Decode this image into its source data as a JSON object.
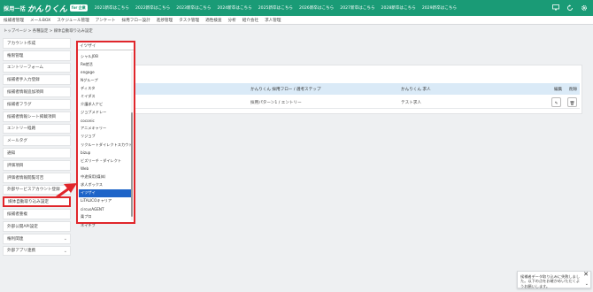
{
  "header": {
    "logo_prefix": "採用一括",
    "logo_name": "かんりくん",
    "logo_badge": "for 企業",
    "year_links": [
      "2021新卒はこちら",
      "2022新卒はこちら",
      "2023新卒はこちら",
      "2024新卒はこちら",
      "2025新卒はこちら",
      "2026新卒はこちら",
      "2027新卒はこちら",
      "2028新卒はこちら",
      "2029新卒はこちら"
    ],
    "icons": [
      "monitor-icon",
      "refresh-icon",
      "gear-icon"
    ]
  },
  "menu": [
    "候補者管理",
    "メールBOX",
    "スケジュール管理",
    "アンケート",
    "採用フロー設計",
    "進捗管理",
    "タスク管理",
    "適性検査",
    "分析",
    "紹介会社",
    "求人管理"
  ],
  "breadcrumb": "トップページ > 各種設定 > 媒体自動取り込み設定",
  "sidebar": [
    {
      "label": "アカウント作成"
    },
    {
      "label": "権限管理"
    },
    {
      "label": "エントリーフォーム"
    },
    {
      "label": "候補者手入力登録"
    },
    {
      "label": "候補者情報追加項目"
    },
    {
      "label": "候補者フラグ"
    },
    {
      "label": "候補者情報シート掲載項目"
    },
    {
      "label": "エントリー経路"
    },
    {
      "label": "メールタグ"
    },
    {
      "label": "通知"
    },
    {
      "label": "評価項目"
    },
    {
      "label": "評価者情報閲覧可否"
    },
    {
      "label": "外部サービスアカウント登録"
    },
    {
      "label": "媒体自動取り込み設定",
      "active": true
    },
    {
      "label": "候補者重複"
    },
    {
      "label": "外部公開API設定"
    },
    {
      "label": "権利関連",
      "chevron": true
    },
    {
      "label": "外部アプリ連携",
      "chevron": true
    }
  ],
  "table": {
    "headers": [
      "かんりくん 採用フロー / 選考ステップ",
      "かんりくん 求人",
      "編集",
      "削除"
    ],
    "row": {
      "flow": "採用パターン1 / エントリー",
      "job": "テスト求人"
    }
  },
  "dropdown": {
    "selected_value": "イツザイ",
    "options": [
      "シャルJOB",
      "Re就活",
      "engage",
      "Nグループ",
      "ディスタ",
      "ミイダス",
      "介護求人ナビ",
      "ジョブメドレー",
      "coconic",
      "アニメキャリー",
      "リジョブ",
      "リクルートダイレクトスカウト",
      "bizup",
      "ビズリーチ・ダイレクト",
      "Web",
      "中途採用(媒体)",
      "求人ボックス",
      "イツザイ",
      "LiTALICOキャリア",
      "circusAGENT",
      "楽プロ",
      "ネイチブ"
    ],
    "selected_index": 17
  },
  "toast": {
    "text": "候補者データ取り込みに失敗しました。以下の点をお確かめいただくようお願いします。",
    "close_symbol": "✕",
    "more_symbol": "⌄"
  },
  "colors": {
    "brand": "#1a9b76",
    "highlight": "#e0262b",
    "selection": "#1e64c8",
    "table_header": "#daeaf7"
  }
}
